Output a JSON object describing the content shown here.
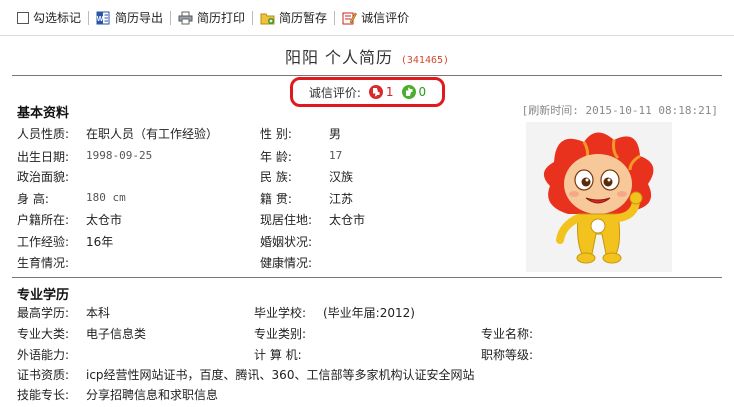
{
  "toolbar": {
    "select_mark": "勾选标记",
    "export": "简历导出",
    "print": "简历打印",
    "save_draft": "简历暂存",
    "credit_eval": "诚信评价"
  },
  "header": {
    "name": "阳阳  个人简历",
    "resume_id": "(341465)"
  },
  "credit": {
    "label": "诚信评价:",
    "negative": "1",
    "positive": "0"
  },
  "refresh_time": "[刷新时间: 2015-10-11 08:18:21]",
  "basic": {
    "title": "基本资料",
    "fields": {
      "type_label": "人员性质:",
      "type_value": "在职人员（有工作经验）",
      "gender_label": "性    别:",
      "gender_value": "男",
      "birth_label": "出生日期:",
      "birth_value": "1998-09-25",
      "age_label": "年    龄:",
      "age_value": "17",
      "politics_label": "政治面貌:",
      "politics_value": "",
      "ethnic_label": "民    族:",
      "ethnic_value": "汉族",
      "height_label": "身    高:",
      "height_value": "180 cm",
      "origin_label": "籍    贯:",
      "origin_value": "江苏",
      "hukou_label": "户籍所在:",
      "hukou_value": "太仓市",
      "residence_label": "现居住地:",
      "residence_value": "太仓市",
      "experience_label": "工作经验:",
      "experience_value": "16年",
      "marriage_label": "婚姻状况:",
      "marriage_value": "",
      "fertility_label": "生育情况:",
      "fertility_value": "",
      "health_label": "健康情况:",
      "health_value": ""
    }
  },
  "education": {
    "title": "专业学历",
    "fields": {
      "degree_label": "最高学历:",
      "degree_value": "本科",
      "school_label": "毕业学校:",
      "school_value": "(毕业年届:2012)",
      "major_cat_label": "专业大类:",
      "major_cat_value": "电子信息类",
      "major_type_label": "专业类别:",
      "major_type_value": "",
      "major_name_label": "专业名称:",
      "major_name_value": "",
      "lang_label": "外语能力:",
      "lang_value": "",
      "computer_label": "计 算 机:",
      "computer_value": "",
      "title_level_label": "职称等级:",
      "title_level_value": "",
      "cert_label": "证书资质:",
      "cert_value": "icp经营性网站证书，百度、腾讯、360、工信部等多家机构认证安全网站",
      "skill_label": "技能专长:",
      "skill_value": "分享招聘信息和求职信息"
    }
  },
  "colors": {
    "accent_red": "#e0191c",
    "id_red": "#d24a2a",
    "green": "#2a9a18"
  }
}
